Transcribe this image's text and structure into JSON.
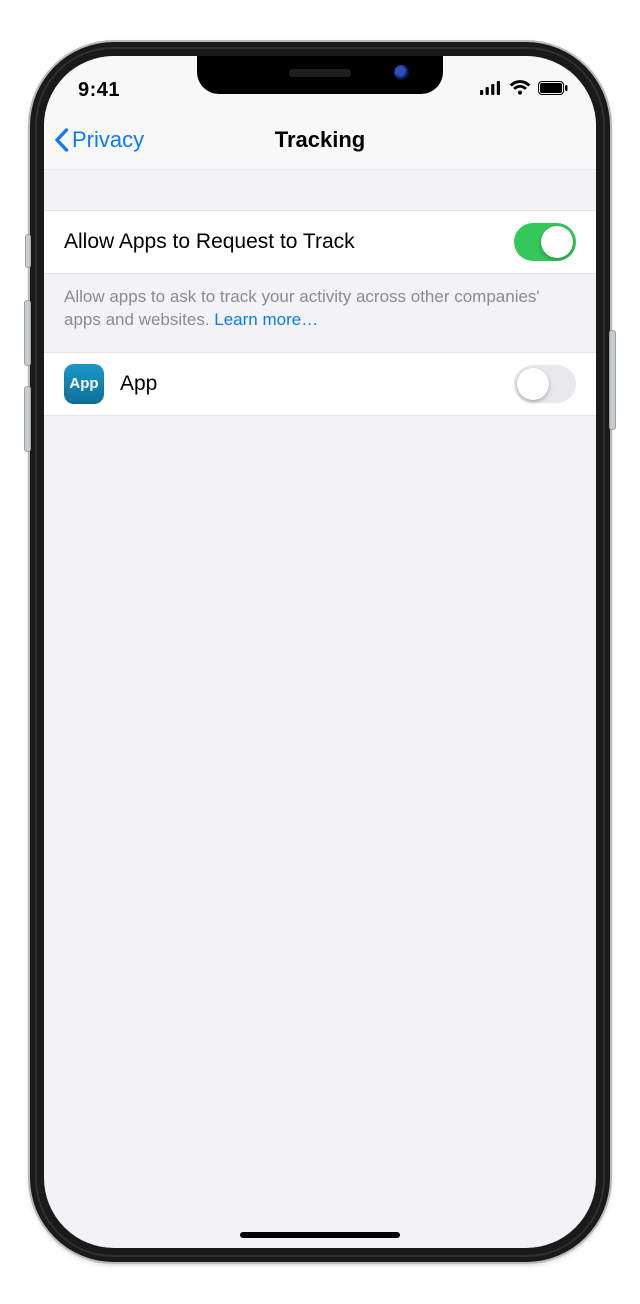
{
  "status": {
    "time": "9:41"
  },
  "nav": {
    "back": "Privacy",
    "title": "Tracking"
  },
  "rows": {
    "allow": {
      "label": "Allow Apps to Request to Track",
      "on": true
    }
  },
  "caption": {
    "text": "Allow apps to ask to track your activity across other companies' apps and websites. ",
    "link": "Learn more…"
  },
  "apps": [
    {
      "name": "App",
      "icon_label": "App",
      "on": false
    }
  ],
  "colors": {
    "accent": "#0b79ff",
    "toggle_on": "#34c759"
  }
}
